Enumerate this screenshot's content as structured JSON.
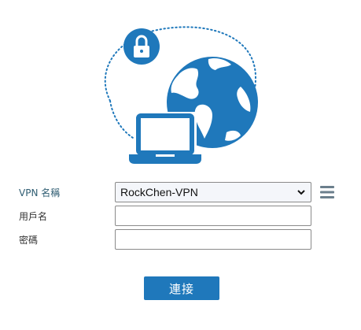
{
  "colors": {
    "accent": "#1f78bb",
    "label": "#2f5d72",
    "menu_icon": "#6b7f8c"
  },
  "illustration": {
    "icons": [
      "lock-icon",
      "globe-icon",
      "laptop-icon",
      "dotted-orbit"
    ]
  },
  "form": {
    "vpn_name_label": "VPN 名稱",
    "vpn_name_value": "RockChen-VPN",
    "menu_icon": "hamburger-menu-icon",
    "username_label": "用戶名",
    "username_value": "",
    "password_label": "密碼",
    "password_value": ""
  },
  "actions": {
    "connect_label": "連接"
  }
}
